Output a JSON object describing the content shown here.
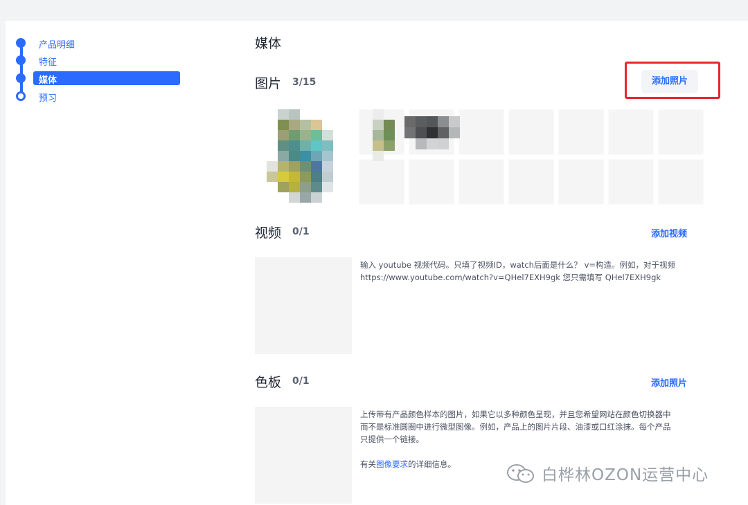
{
  "sidebar": {
    "steps": [
      {
        "label": "产品明细",
        "state": "done"
      },
      {
        "label": "特征",
        "state": "done"
      },
      {
        "label": "媒体",
        "state": "active"
      },
      {
        "label": "预习",
        "state": "pending"
      }
    ]
  },
  "main": {
    "heading": "媒体",
    "photos": {
      "title": "图片",
      "count": "3/15",
      "add_label": "添加照片"
    },
    "video": {
      "title": "视频",
      "count": "0/1",
      "add_label": "添加视频",
      "description_line1": "输入 youtube 视频代码。只填了视频ID，watch后面是什么？ v=构造。例如，对于视频",
      "description_line2": "https://www.youtube.com/watch?v=QHel7EXH9gk 您只需填写 QHel7EXH9gk"
    },
    "swatch": {
      "title": "色板",
      "count": "0/1",
      "add_label": "添加照片",
      "description_line1": "上传带有产品颜色样本的图片，如果它以多种颜色呈现，并且您希望网站在颜色切换器中",
      "description_line2": "而不是标准圆圈中进行微型图像。例如，产品上的图片片段、油漆或口红涂抹。每个产品",
      "description_line3": "只提供一个链接。",
      "info_prefix": "有关",
      "info_link": "图像要求",
      "info_suffix": "的详细信息。"
    }
  },
  "watermark": {
    "text": "白桦林OZON运营中心"
  },
  "colors": {
    "accent": "#2b6bff",
    "highlight": "#e8262b"
  }
}
